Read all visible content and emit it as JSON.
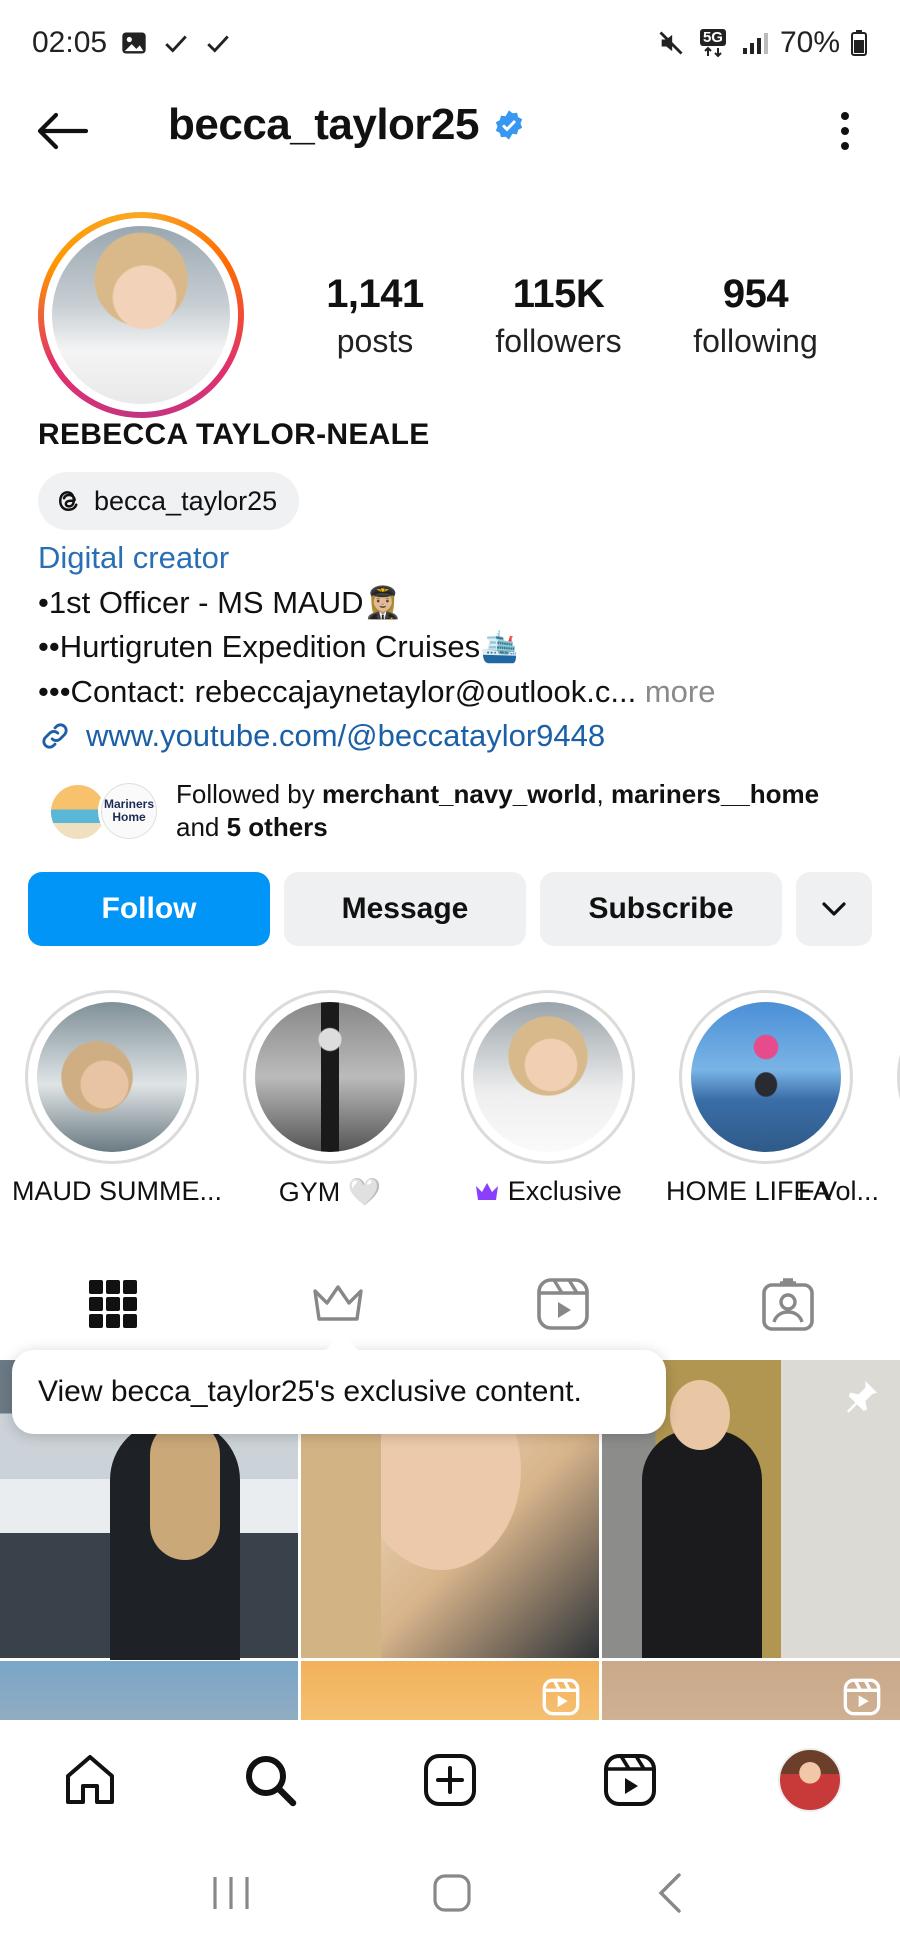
{
  "status_bar": {
    "time": "02:05",
    "left_icons": [
      "gallery-icon",
      "check-icon",
      "check-icon"
    ],
    "right_icons": [
      "mute-icon",
      "5g-icon",
      "signal-icon",
      "battery-icon"
    ],
    "network": "5G",
    "battery": "70%"
  },
  "header": {
    "username": "becca_taylor25",
    "verified": true,
    "verified_color": "#3897f0"
  },
  "profile": {
    "stats": [
      {
        "value": "1,141",
        "label": "posts"
      },
      {
        "value": "115K",
        "label": "followers"
      },
      {
        "value": "954",
        "label": "following"
      }
    ],
    "full_name": "REBECCA TAYLOR-NEALE",
    "threads_handle": "becca_taylor25",
    "category": "Digital creator",
    "bio_lines": [
      "•1st Officer - MS MAUD👩🏼‍✈️",
      "••Hurtigruten Expedition Cruises🛳️",
      "•••Contact: rebeccajaynetaylor@outlook.c..."
    ],
    "bio_more": " more",
    "link": "www.youtube.com/@beccataylor9448",
    "followed_by": {
      "prefix": "Followed by ",
      "user1": "merchant_navy_world",
      "sep": ", ",
      "user2": "mariners__home",
      "and": "and ",
      "others": "5 others",
      "mutual2_label": "Mariners Home"
    }
  },
  "actions": {
    "follow": "Follow",
    "message": "Message",
    "subscribe": "Subscribe",
    "follow_color": "#0095f6"
  },
  "highlights": [
    {
      "label": "MAUD SUMME..."
    },
    {
      "label": "GYM 🤍"
    },
    {
      "label": "Exclusive",
      "prefix_icon": "crown-icon"
    },
    {
      "label": "HOME LIFE Vol..."
    },
    {
      "label": "FA"
    }
  ],
  "tabs": [
    "grid-icon",
    "crown-icon",
    "reels-icon",
    "tagged-icon"
  ],
  "tooltip": "View becca_taylor25's exclusive content.",
  "grid_badges": [
    "pin-icon",
    "reels-icon",
    "reels-icon"
  ],
  "bottom_nav": [
    "home-icon",
    "search-icon",
    "create-icon",
    "reels-icon",
    "profile-avatar"
  ],
  "system_nav": [
    "recents-icon",
    "home-button-icon",
    "back-icon"
  ]
}
